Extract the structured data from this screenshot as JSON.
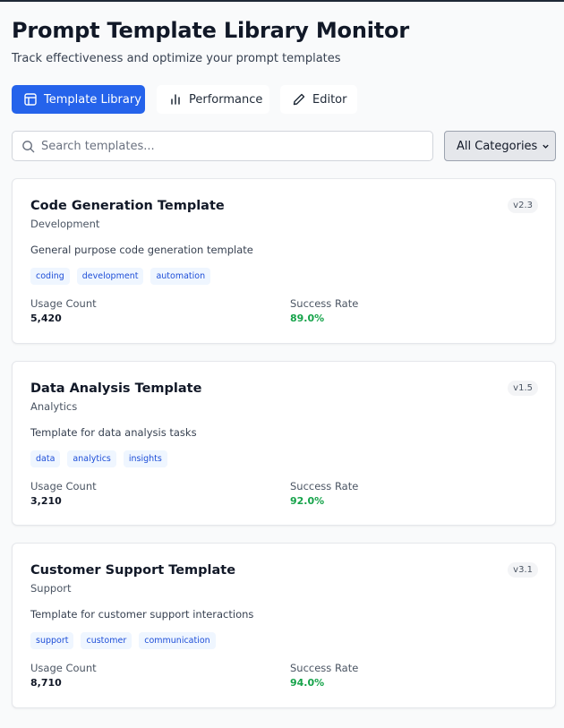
{
  "header": {
    "title": "Prompt Template Library Monitor",
    "subtitle": "Track effectiveness and optimize your prompt templates"
  },
  "tabs": [
    {
      "label": "Template Library",
      "icon": "layout-icon",
      "active": true
    },
    {
      "label": "Performance",
      "icon": "bar-chart-icon",
      "active": false
    },
    {
      "label": "Editor",
      "icon": "pencil-icon",
      "active": false
    }
  ],
  "search": {
    "placeholder": "Search templates...",
    "value": ""
  },
  "category_filter": {
    "selected": "All Categories"
  },
  "stat_labels": {
    "usage": "Usage Count",
    "success": "Success Rate"
  },
  "templates": [
    {
      "name": "Code Generation Template",
      "category": "Development",
      "version": "v2.3",
      "description": "General purpose code generation template",
      "tags": [
        "coding",
        "development",
        "automation"
      ],
      "usage_count": "5,420",
      "success_rate": "89.0%"
    },
    {
      "name": "Data Analysis Template",
      "category": "Analytics",
      "version": "v1.5",
      "description": "Template for data analysis tasks",
      "tags": [
        "data",
        "analytics",
        "insights"
      ],
      "usage_count": "3,210",
      "success_rate": "92.0%"
    },
    {
      "name": "Customer Support Template",
      "category": "Support",
      "version": "v3.1",
      "description": "Template for customer support interactions",
      "tags": [
        "support",
        "customer",
        "communication"
      ],
      "usage_count": "8,710",
      "success_rate": "94.0%"
    }
  ],
  "colors": {
    "accent": "#2563eb",
    "success": "#16a34a",
    "tag_bg": "#eff6ff",
    "tag_text": "#1d4ed8"
  }
}
